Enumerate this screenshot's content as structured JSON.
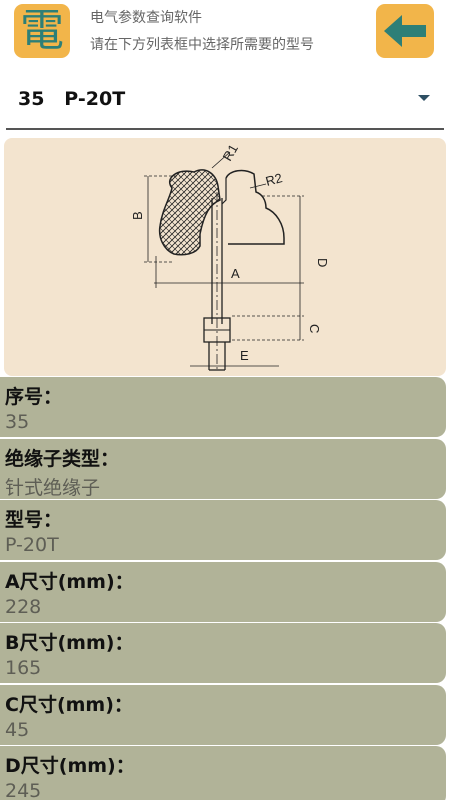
{
  "header": {
    "app_icon_char": "電",
    "line1": "电气参数查询软件",
    "line2": "请在下方列表框中选择所需要的型号",
    "back_icon": "arrow-left-icon"
  },
  "selector": {
    "value": "35   P-20T",
    "dropdown_icon": "caret-down-icon"
  },
  "diagram": {
    "labels": {
      "r1": "R1",
      "r2": "R2",
      "a": "A",
      "b": "B",
      "c": "C",
      "d": "D",
      "e": "E"
    }
  },
  "fields": [
    {
      "label": "序号：",
      "value": "35"
    },
    {
      "label": "绝缘子类型：",
      "value": "针式绝缘子"
    },
    {
      "label": "型号：",
      "value": "P-20T"
    },
    {
      "label": "A尺寸(mm)：",
      "value": "228"
    },
    {
      "label": "B尺寸(mm)：",
      "value": "165"
    },
    {
      "label": "C尺寸(mm)：",
      "value": "45"
    },
    {
      "label": "D尺寸(mm)：",
      "value": "245"
    }
  ],
  "colors": {
    "accent": "#f2b54a",
    "icon_teal": "#2d7f77",
    "row_bg": "#b1b398",
    "diagram_bg": "#f3e4cf"
  }
}
